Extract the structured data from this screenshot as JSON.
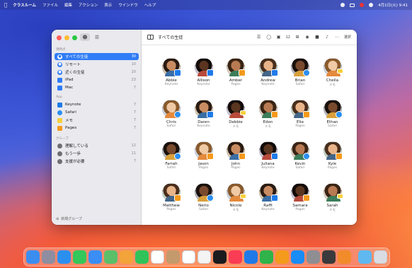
{
  "menubar": {
    "app_name": "クラスルーム",
    "menus": [
      "ファイル",
      "編集",
      "アクション",
      "表示",
      "ウインドウ",
      "ヘルプ"
    ],
    "clock": "4月1日(火) 9:41"
  },
  "sidebar": {
    "section_classes": "現時点",
    "classes": [
      {
        "label": "すべての生徒",
        "count": "30",
        "icon": "group-icon",
        "selected": true
      },
      {
        "label": "リモート",
        "count": "10",
        "icon": "remote-icon"
      },
      {
        "label": "近くの生徒",
        "count": "20",
        "icon": "nearby-icon"
      },
      {
        "label": "iPad",
        "count": "23",
        "icon": "ipad-icon"
      },
      {
        "label": "Mac",
        "count": "7",
        "icon": "mac-icon"
      }
    ],
    "section_apps": "App",
    "apps": [
      {
        "label": "Keynote",
        "count": "7",
        "icon": "keynote-icon",
        "color": "#1f7ae8"
      },
      {
        "label": "Safari",
        "count": "7",
        "icon": "safari-icon",
        "color": "#2b8ff0"
      },
      {
        "label": "メモ",
        "count": "7",
        "icon": "notes-icon",
        "color": "#f7d13c"
      },
      {
        "label": "Pages",
        "count": "7",
        "icon": "pages-icon",
        "color": "#f49a1c"
      }
    ],
    "section_groups": "グループ",
    "groups": [
      {
        "label": "理解している",
        "count": "12",
        "icon": "group-icon"
      },
      {
        "label": "もう一歩",
        "count": "11",
        "icon": "group-icon"
      },
      {
        "label": "支援が必要",
        "count": "7",
        "icon": "group-icon"
      }
    ],
    "new_group": "新規グループ"
  },
  "toolbar": {
    "title": "すべての生徒",
    "badge_count": "12",
    "select_label": "選択"
  },
  "students": [
    {
      "name": "Abbie",
      "app": "Keynote",
      "badge": "keynote"
    },
    {
      "name": "Allison",
      "app": "Keynote",
      "badge": "keynote"
    },
    {
      "name": "Amber",
      "app": "Pages",
      "badge": "pages"
    },
    {
      "name": "Andrew",
      "app": "Keynote",
      "badge": "keynote"
    },
    {
      "name": "Brian",
      "app": "Safari",
      "badge": "safari"
    },
    {
      "name": "Chella",
      "app": "メモ",
      "badge": "memo"
    },
    {
      "name": "Chris",
      "app": "Safari",
      "badge": "safari"
    },
    {
      "name": "Daren",
      "app": "Keynote",
      "badge": "keynote"
    },
    {
      "name": "Debbie",
      "app": "メモ",
      "badge": "memo"
    },
    {
      "name": "Eden",
      "app": "メモ",
      "badge": "pages"
    },
    {
      "name": "Elie",
      "app": "Pages",
      "badge": "pages"
    },
    {
      "name": "Ethan",
      "app": "Safari",
      "badge": "safari"
    },
    {
      "name": "Farrah",
      "app": "Safari",
      "badge": "safari"
    },
    {
      "name": "Jason",
      "app": "Pages",
      "badge": "pages"
    },
    {
      "name": "John",
      "app": "Pages",
      "badge": "pages"
    },
    {
      "name": "Juliana",
      "app": "Keynote",
      "badge": "keynote"
    },
    {
      "name": "Kevin",
      "app": "Safari",
      "badge": "safari"
    },
    {
      "name": "Kyle",
      "app": "Pages",
      "badge": "pages"
    },
    {
      "name": "Matthew",
      "app": "Pages",
      "badge": "pages"
    },
    {
      "name": "Nerio",
      "app": "Safari",
      "badge": "safari"
    },
    {
      "name": "Nicole",
      "app": "メモ",
      "badge": "memo"
    },
    {
      "name": "Raffi",
      "app": "Keynote",
      "badge": "keynote"
    },
    {
      "name": "Samara",
      "app": "Pages",
      "badge": "pages"
    },
    {
      "name": "Sarah",
      "app": "メモ",
      "badge": "memo"
    }
  ],
  "dock": [
    {
      "icon": "finder-icon",
      "color": "#3b8df0"
    },
    {
      "icon": "launchpad-icon",
      "color": "#8e8ea0"
    },
    {
      "icon": "safari-icon",
      "color": "#2b8ff0"
    },
    {
      "icon": "messages-icon",
      "color": "#34c759"
    },
    {
      "icon": "mail-icon",
      "color": "#3a8ef6"
    },
    {
      "icon": "maps-icon",
      "color": "#5bbf6a"
    },
    {
      "icon": "photos-icon",
      "color": "#f2a33a"
    },
    {
      "icon": "facetime-icon",
      "color": "#30c35a"
    },
    {
      "icon": "calendar-icon",
      "color": "#ffffff"
    },
    {
      "icon": "contacts-icon",
      "color": "#c49a6c"
    },
    {
      "icon": "reminders-icon",
      "color": "#ffffff"
    },
    {
      "icon": "freeform-icon",
      "color": "#f4f4f4"
    },
    {
      "icon": "tv-icon",
      "color": "#1c1c1e"
    },
    {
      "icon": "music-icon",
      "color": "#fa3c55"
    },
    {
      "icon": "keynote-icon",
      "color": "#1f7ae8"
    },
    {
      "icon": "numbers-icon",
      "color": "#2fb34a"
    },
    {
      "icon": "pages-icon",
      "color": "#f49a1c"
    },
    {
      "icon": "appstore-icon",
      "color": "#1a8cf5"
    },
    {
      "icon": "settings-icon",
      "color": "#8e8e93"
    },
    {
      "icon": "iphone-mirroring-icon",
      "color": "#3a3a3c"
    },
    {
      "icon": "classroom-icon",
      "color": "#f28b2a"
    },
    {
      "icon": "downloads-folder-icon",
      "color": "#5fb8f0"
    },
    {
      "icon": "trash-icon",
      "color": "#d9dde3"
    }
  ]
}
